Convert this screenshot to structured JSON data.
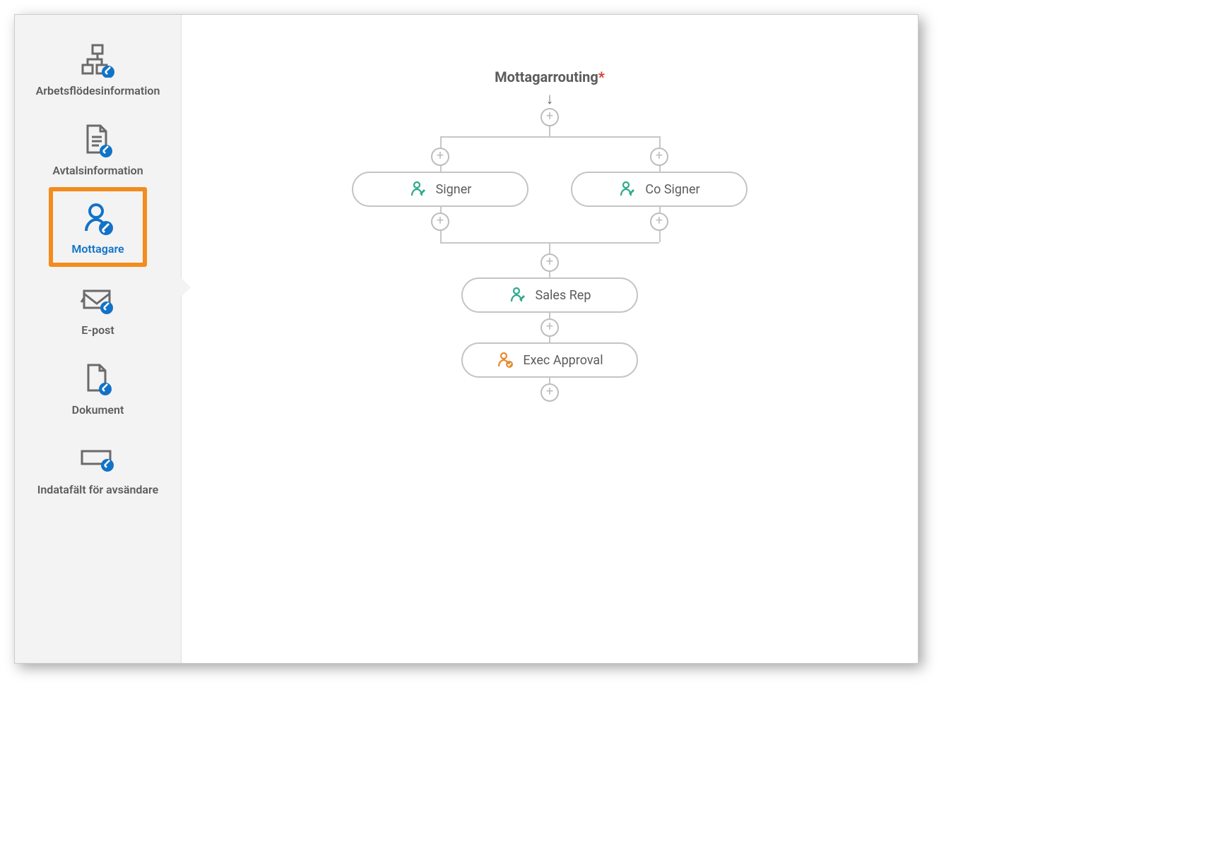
{
  "sidebar": {
    "items": [
      {
        "label": "Arbetsflödesinformation"
      },
      {
        "label": "Avtalsinformation"
      },
      {
        "label": "Mottagare"
      },
      {
        "label": "E-post"
      },
      {
        "label": "Dokument"
      },
      {
        "label": "Indatafält för avsändare"
      }
    ],
    "selected_index": 2
  },
  "main": {
    "title": "Mottagarrouting",
    "required_marker": "*"
  },
  "routing_nodes": [
    {
      "label": "Signer",
      "role": "signer",
      "row": 0,
      "branch": "left"
    },
    {
      "label": "Co Signer",
      "role": "signer",
      "row": 0,
      "branch": "right"
    },
    {
      "label": "Sales Rep",
      "role": "signer",
      "row": 1,
      "branch": "center"
    },
    {
      "label": "Exec Approval",
      "role": "approver",
      "row": 2,
      "branch": "center"
    }
  ],
  "colors": {
    "accent_blue": "#1173c7",
    "highlight_orange": "#f28c1e",
    "signer_green": "#2fa98c",
    "approver_orange": "#e88a2d"
  }
}
